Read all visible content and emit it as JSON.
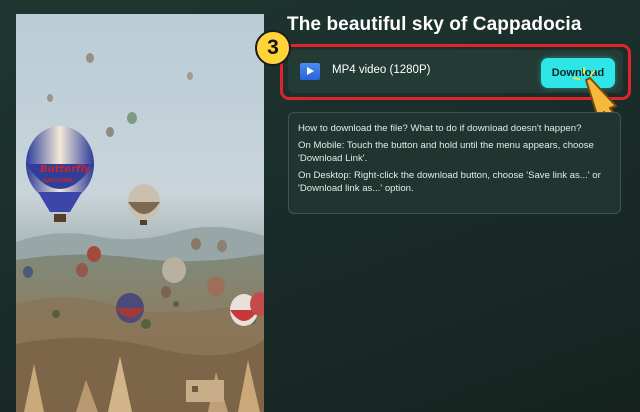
{
  "page": {
    "title": "The beautiful sky of Cappadocia"
  },
  "step_badge": {
    "number": "3",
    "color": "#ffd43b"
  },
  "download_option": {
    "icon": "video-file-icon",
    "label": "MP4 video (1280P)",
    "button_label": "Download",
    "button_color": "#2ee6e8",
    "highlight_color": "#e0242c"
  },
  "help": {
    "lines": [
      "How to download the file? What to do if download doesn't happen?",
      "On Mobile: Touch the button and hold until the menu appears, choose 'Download Link'.",
      "On Desktop: Right-click the download button, choose 'Save link as...' or 'Download link as...' option."
    ]
  },
  "photo": {
    "balloon_text_1": "Butterfly",
    "balloon_text_2": "BALLOONS"
  },
  "cursor": {
    "icon": "hand-pointer-icon"
  }
}
